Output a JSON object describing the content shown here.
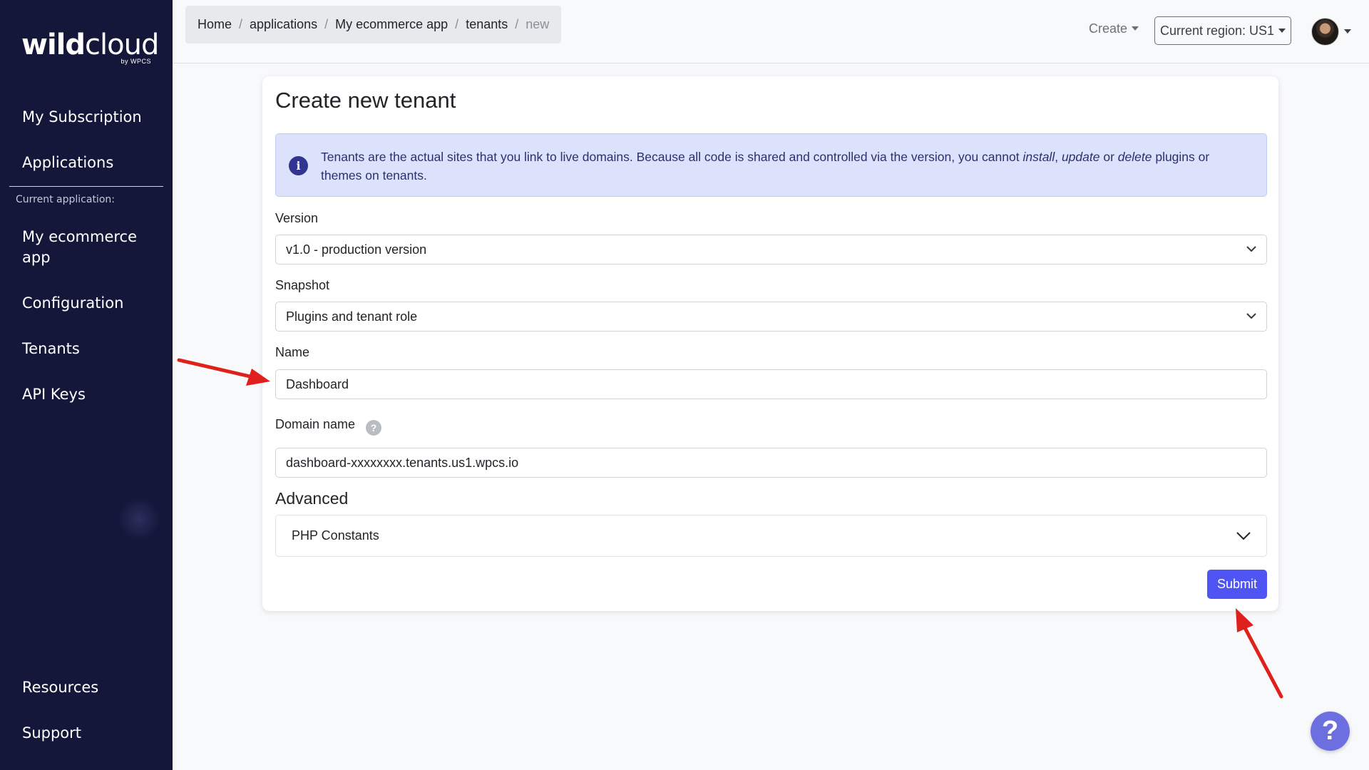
{
  "sidebar": {
    "logo": {
      "main_bold": "wild",
      "main_light": "cloud",
      "sub": "by WPCS"
    },
    "items": [
      {
        "label": "My Subscription"
      },
      {
        "label": "Applications"
      }
    ],
    "caption": "Current application:",
    "app_items": [
      {
        "label": "My ecommerce app"
      },
      {
        "label": "Configuration"
      },
      {
        "label": "Tenants"
      },
      {
        "label": "API Keys"
      }
    ],
    "bottom_items": [
      {
        "label": "Resources"
      },
      {
        "label": "Support"
      }
    ]
  },
  "breadcrumb": [
    "Home",
    "applications",
    "My ecommerce app",
    "tenants",
    "new"
  ],
  "header": {
    "create_label": "Create",
    "region_label": "Current region: US1"
  },
  "form": {
    "title": "Create new tenant",
    "alert": {
      "icon": "info-icon",
      "text_before": "Tenants are the actual sites that you link to live domains. Because all code is shared and controlled via the version, you cannot ",
      "em1": "install",
      "sep1": ", ",
      "em2": "update",
      "sep2": " or ",
      "em3": "delete",
      "text_after": " plugins or themes on tenants."
    },
    "version": {
      "label": "Version",
      "value": "v1.0 - production version"
    },
    "snapshot": {
      "label": "Snapshot",
      "value": "Plugins and tenant role"
    },
    "name": {
      "label": "Name",
      "value": "Dashboard"
    },
    "domain": {
      "label": "Domain name",
      "value": "dashboard-xxxxxxxx.tenants.us1.wpcs.io",
      "help": "?"
    },
    "advanced": {
      "title": "Advanced",
      "accordion_label": "PHP Constants"
    },
    "submit_label": "Submit"
  },
  "help_fab": "?",
  "colors": {
    "sidebar": "#14173a",
    "accent": "#4f55f2",
    "annotation_arrow": "#e0201c"
  }
}
